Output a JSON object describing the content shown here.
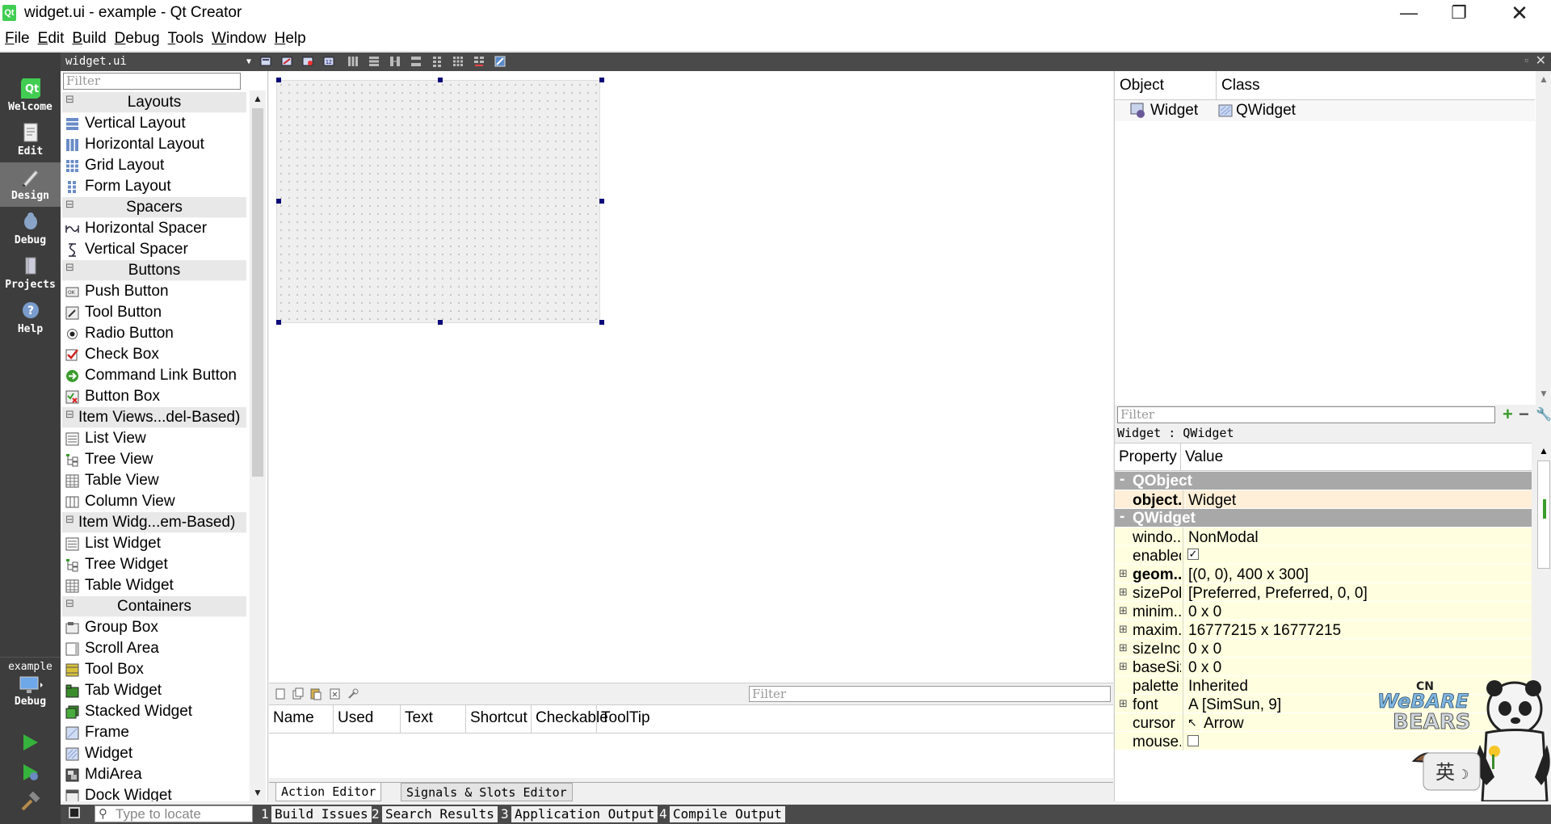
{
  "window": {
    "title": "widget.ui - example - Qt Creator",
    "app_icon": "Qt",
    "controls": [
      "minimize-icon",
      "restore-icon",
      "close-icon"
    ]
  },
  "menubar": {
    "items": [
      {
        "label": "File",
        "mnemonic": "F",
        "rest": "ile"
      },
      {
        "label": "Edit",
        "mnemonic": "E",
        "rest": "dit"
      },
      {
        "label": "Build",
        "mnemonic": "B",
        "rest": "uild"
      },
      {
        "label": "Debug",
        "mnemonic": "D",
        "rest": "ebug"
      },
      {
        "label": "Tools",
        "mnemonic": "T",
        "rest": "ools"
      },
      {
        "label": "Window",
        "mnemonic": "W",
        "rest": "indow"
      },
      {
        "label": "Help",
        "mnemonic": "H",
        "rest": "elp"
      }
    ]
  },
  "modes": [
    {
      "label": "Welcome",
      "icon": "qt-logo-icon"
    },
    {
      "label": "Edit",
      "icon": "document-icon"
    },
    {
      "label": "Design",
      "icon": "pen-icon",
      "active": true
    },
    {
      "label": "Debug",
      "icon": "bug-icon"
    },
    {
      "label": "Projects",
      "icon": "wrench-icon"
    },
    {
      "label": "Help",
      "icon": "help-icon"
    }
  ],
  "project_selector": {
    "project": "example",
    "config": "Debug"
  },
  "editor": {
    "file_combo": "widget.ui"
  },
  "widget_box": {
    "filter_placeholder": "Filter",
    "categories": [
      {
        "name": "Layouts",
        "items": [
          "Vertical Layout",
          "Horizontal Layout",
          "Grid Layout",
          "Form Layout"
        ]
      },
      {
        "name": "Spacers",
        "items": [
          "Horizontal Spacer",
          "Vertical Spacer"
        ]
      },
      {
        "name": "Buttons",
        "items": [
          "Push Button",
          "Tool Button",
          "Radio Button",
          "Check Box",
          "Command Link Button",
          "Button Box"
        ]
      },
      {
        "name": "Item Views...del-Based)",
        "items": [
          "List View",
          "Tree View",
          "Table View",
          "Column View"
        ]
      },
      {
        "name": "Item Widg...em-Based)",
        "items": [
          "List Widget",
          "Tree Widget",
          "Table Widget"
        ]
      },
      {
        "name": "Containers",
        "items": [
          "Group Box",
          "Scroll Area",
          "Tool Box",
          "Tab Widget",
          "Stacked Widget",
          "Frame",
          "Widget",
          "MdiArea",
          "Dock Widget"
        ]
      }
    ]
  },
  "action_editor": {
    "filter_placeholder": "Filter",
    "columns": [
      "Name",
      "Used",
      "Text",
      "Shortcut",
      "Checkable",
      "ToolTip"
    ],
    "tabs": [
      "Action Editor",
      "Signals & Slots Editor"
    ]
  },
  "object_inspector": {
    "columns": [
      "Object",
      "Class"
    ],
    "rows": [
      {
        "object": "Widget",
        "class": "QWidget"
      }
    ]
  },
  "property_editor": {
    "filter_placeholder": "Filter",
    "caption": "Widget : QWidget",
    "columns": [
      "Property",
      "Value"
    ],
    "groups": [
      {
        "name": "QObject",
        "rows": [
          {
            "name": "object...",
            "value": "Widget",
            "bold": true,
            "expandable": false
          }
        ]
      },
      {
        "name": "QWidget",
        "rows": [
          {
            "name": "windo...",
            "value": "NonModal",
            "bold": false,
            "expandable": false
          },
          {
            "name": "enabled",
            "value": "✓",
            "bold": false,
            "expandable": false
          },
          {
            "name": "geom...",
            "value": "[(0, 0), 400 x 300]",
            "bold": true,
            "expandable": true
          },
          {
            "name": "sizePol...",
            "value": "[Preferred, Preferred, 0, 0]",
            "bold": false,
            "expandable": true
          },
          {
            "name": "minim...",
            "value": "0 x 0",
            "bold": false,
            "expandable": true
          },
          {
            "name": "maxim...",
            "value": "16777215 x 16777215",
            "bold": false,
            "expandable": true
          },
          {
            "name": "sizeInc...",
            "value": "0 x 0",
            "bold": false,
            "expandable": true
          },
          {
            "name": "baseSize",
            "value": "0 x 0",
            "bold": false,
            "expandable": true
          },
          {
            "name": "palette",
            "value": "Inherited",
            "bold": false,
            "expandable": false
          },
          {
            "name": "font",
            "value": "A  [SimSun, 9]",
            "bold": false,
            "expandable": true
          },
          {
            "name": "cursor",
            "value": "Arrow",
            "bold": false,
            "expandable": false
          },
          {
            "name": "mouse...",
            "value": "",
            "bold": false,
            "expandable": false
          }
        ]
      }
    ]
  },
  "statusbar": {
    "locate_placeholder": "Type to locate",
    "panes": [
      {
        "num": "1",
        "label": "Build Issues"
      },
      {
        "num": "2",
        "label": "Search Results"
      },
      {
        "num": "3",
        "label": "Application Output"
      },
      {
        "num": "4",
        "label": "Compile Output"
      }
    ]
  },
  "sticker": {
    "brand": "CN",
    "line1": "WeBARE",
    "line2": "BEARS",
    "ime_char": "英"
  },
  "colors": {
    "modebar_bg": "#3d3d3d",
    "toolbar_bg": "#4a4a4a",
    "property_group_bg": "#a8a8a8",
    "property_row_bg": "#ffffe0",
    "selection_handle": "#0a0a78"
  }
}
